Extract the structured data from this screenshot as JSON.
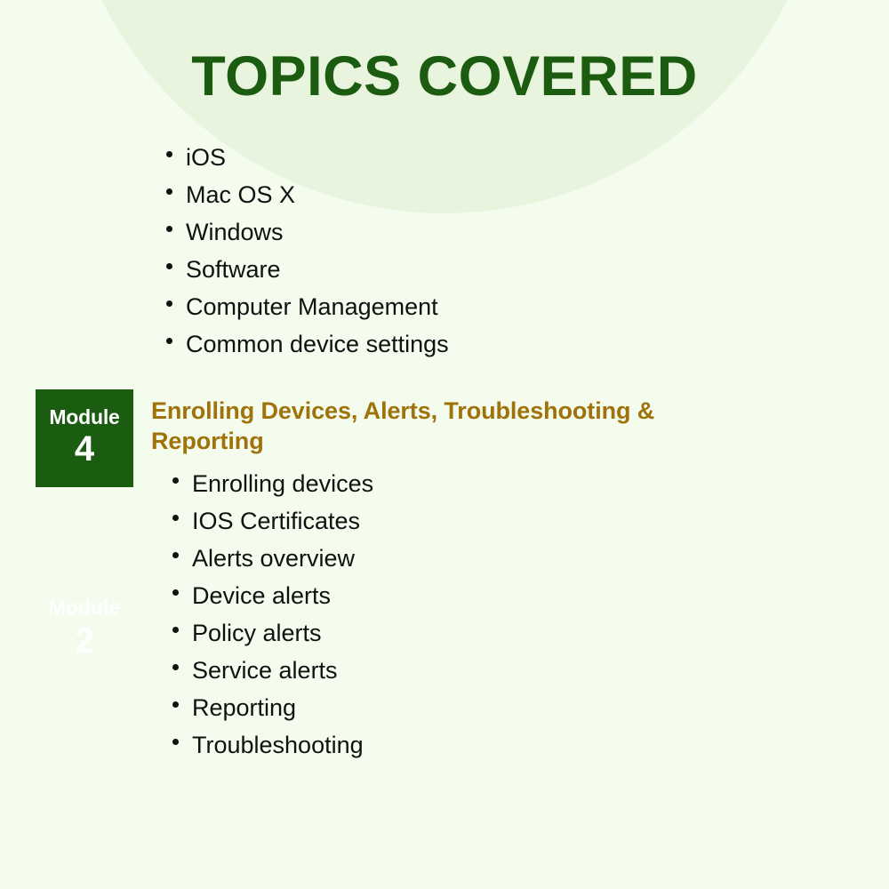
{
  "slide": {
    "title": "TOPICS COVERED",
    "background_color": "#f4fced",
    "circle_color": "#e9f4df",
    "title_color": "#1b5c10",
    "heading_color": "#a0720a",
    "badge_color": "#1a5c10",
    "body_text_color": "#111111"
  },
  "intro_list": {
    "items": [
      "iOS",
      "Mac OS X",
      "Windows",
      "Software",
      "Computer Management",
      "Common device settings"
    ]
  },
  "module": {
    "badge_word": "Module",
    "badge_number": "4",
    "heading": "Enrolling Devices, Alerts, Troubleshooting & Reporting",
    "items": [
      "Enrolling devices",
      "IOS Certificates",
      "Alerts overview",
      "Device alerts",
      "Policy alerts",
      "Service alerts",
      "Reporting",
      "Troubleshooting"
    ]
  },
  "ghost_module": {
    "badge_word": "Module",
    "badge_number": "2"
  }
}
